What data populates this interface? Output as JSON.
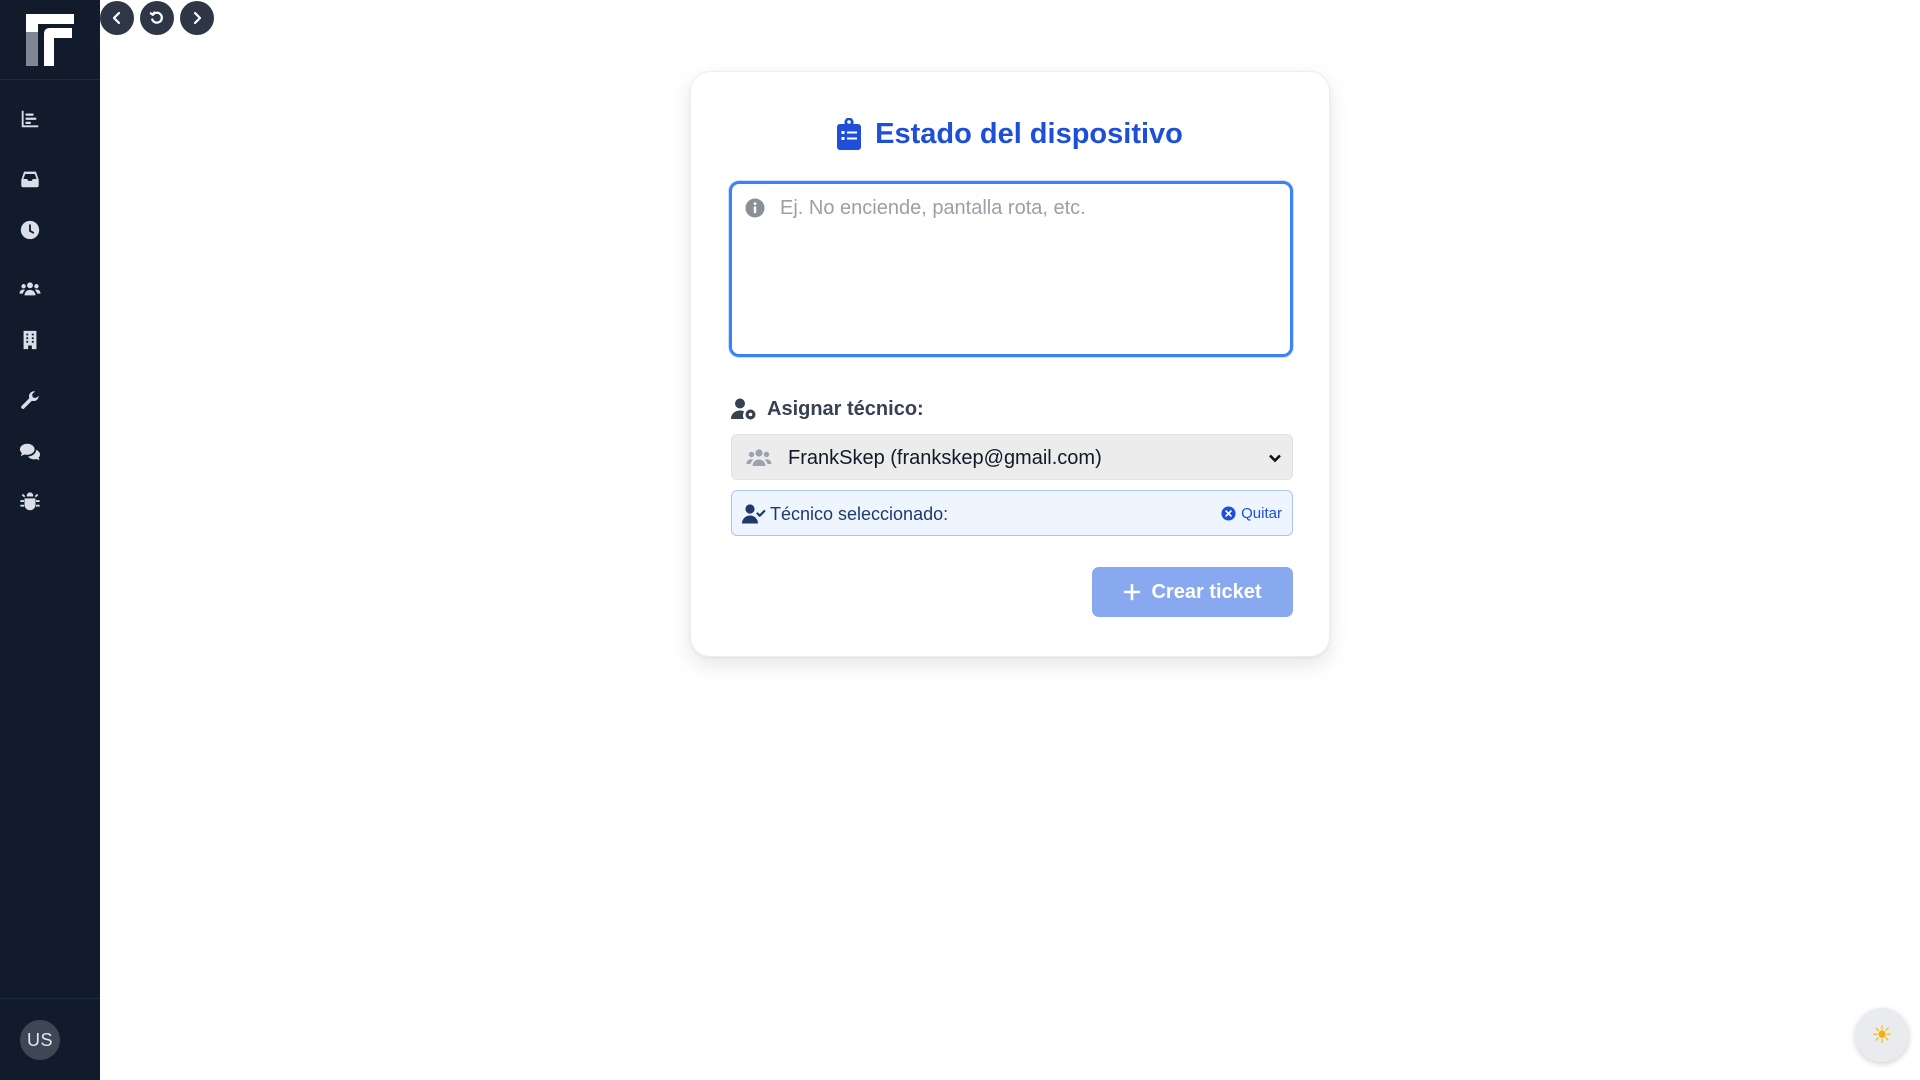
{
  "sidebar": {
    "items": [
      {
        "icon": "chart-bar-icon",
        "name": "dashboard"
      },
      {
        "icon": "inbox-icon",
        "name": "inbox"
      },
      {
        "icon": "clock-icon",
        "name": "history"
      },
      {
        "icon": "users-icon",
        "name": "users"
      },
      {
        "icon": "building-icon",
        "name": "companies"
      },
      {
        "icon": "wrench-icon",
        "name": "tools"
      },
      {
        "icon": "comments-icon",
        "name": "chat"
      },
      {
        "icon": "bug-icon",
        "name": "bugs"
      }
    ],
    "user_initials": "US"
  },
  "nav": {
    "back_icon": "chevron-left-icon",
    "reload_icon": "rotate-icon",
    "forward_icon": "chevron-right-icon"
  },
  "form": {
    "title": "Estado del dispositivo",
    "description_placeholder": "Ej. No enciende, pantalla rota, etc.",
    "description_value": "",
    "assign_label": "Asignar técnico:",
    "technician_selected_option": "FrankSkep (frankskep@gmail.com)",
    "selected_label": "Técnico seleccionado:",
    "remove_label": "Quitar",
    "submit_label": "Crear ticket"
  },
  "colors": {
    "sidebar_bg": "#121b2c",
    "accent": "#1d4fd8",
    "button_disabled": "#88a8ef",
    "focus_border": "#3b82f6"
  },
  "theme_toggle": {
    "icon": "sun-icon",
    "glyph": "☀"
  }
}
